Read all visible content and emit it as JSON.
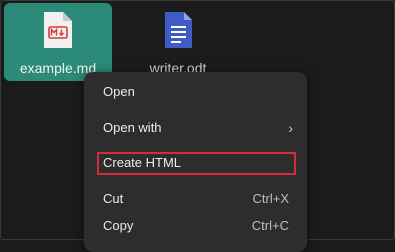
{
  "desktop": {
    "files": [
      {
        "name": "example.md",
        "icon": "markdown-file-icon",
        "selected": true
      },
      {
        "name": "writer.odt",
        "icon": "document-file-icon",
        "selected": false
      }
    ]
  },
  "context_menu": {
    "items": [
      {
        "label": "Open",
        "shortcut": ""
      },
      {
        "label": "Open with",
        "shortcut": "",
        "submenu": true
      },
      {
        "label": "Create HTML",
        "shortcut": "",
        "highlighted": true
      },
      {
        "label": "Cut",
        "shortcut": "Ctrl+X"
      },
      {
        "label": "Copy",
        "shortcut": "Ctrl+C"
      }
    ]
  },
  "colors": {
    "selection": "#2b8a78",
    "highlight_outline": "#d52b3a",
    "menu_bg": "#2d2d2d",
    "desktop_bg": "#1b1b1b"
  }
}
